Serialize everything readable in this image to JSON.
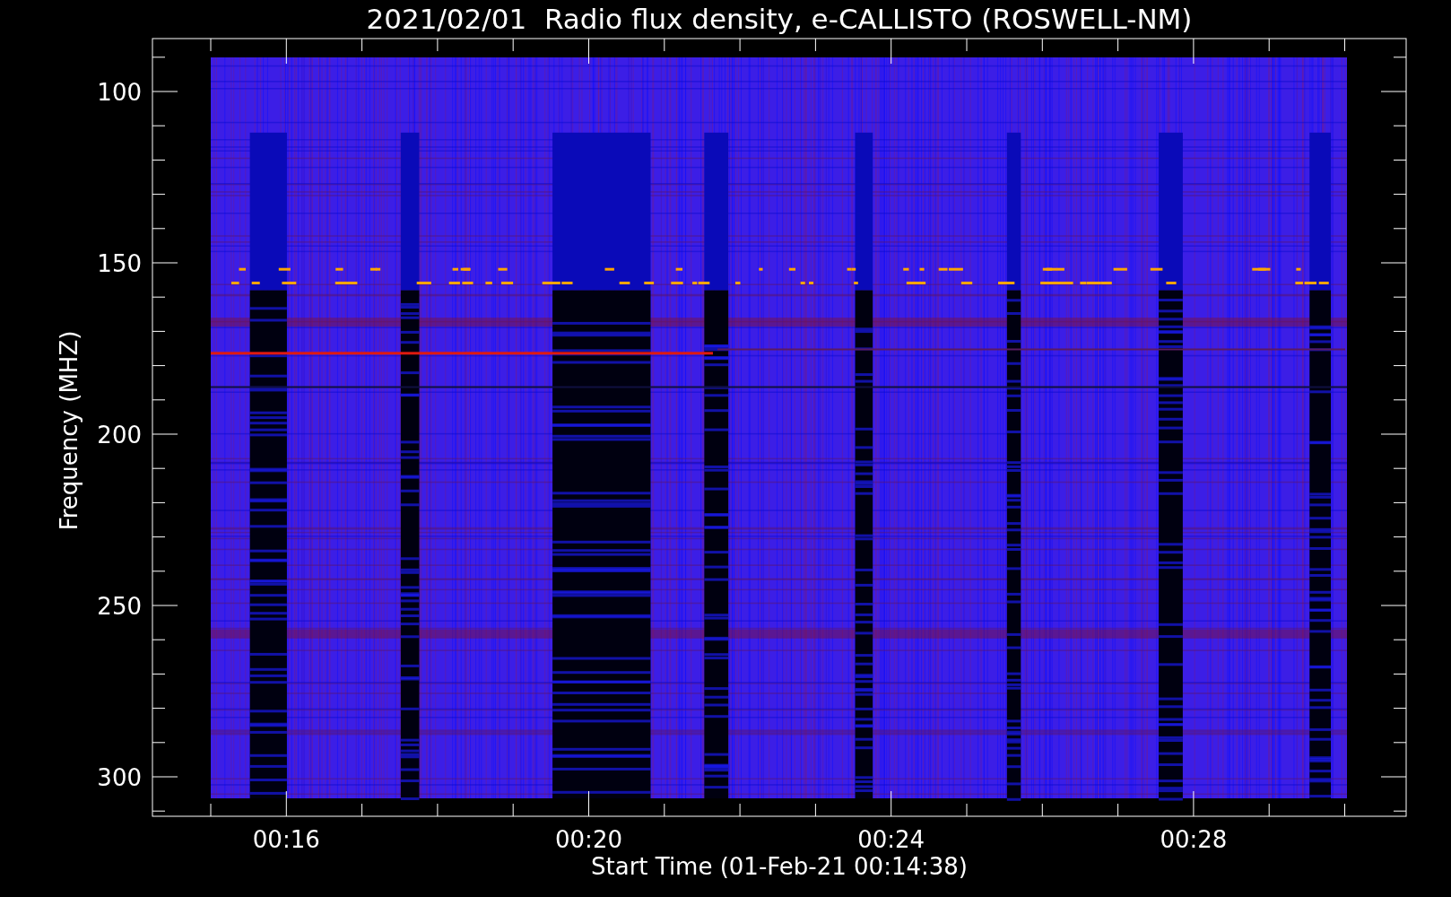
{
  "title": "2021/02/01  Radio flux density, e-CALLISTO (ROSWELL-NM)",
  "ylabel": "Frequency (MHZ)",
  "xlabel": "Start Time (01-Feb-21 00:14:38)",
  "y_ticks": [
    "100",
    "150",
    "200",
    "250",
    "300"
  ],
  "x_ticks": [
    "00:16",
    "00:20",
    "00:24",
    "00:28"
  ]
}
